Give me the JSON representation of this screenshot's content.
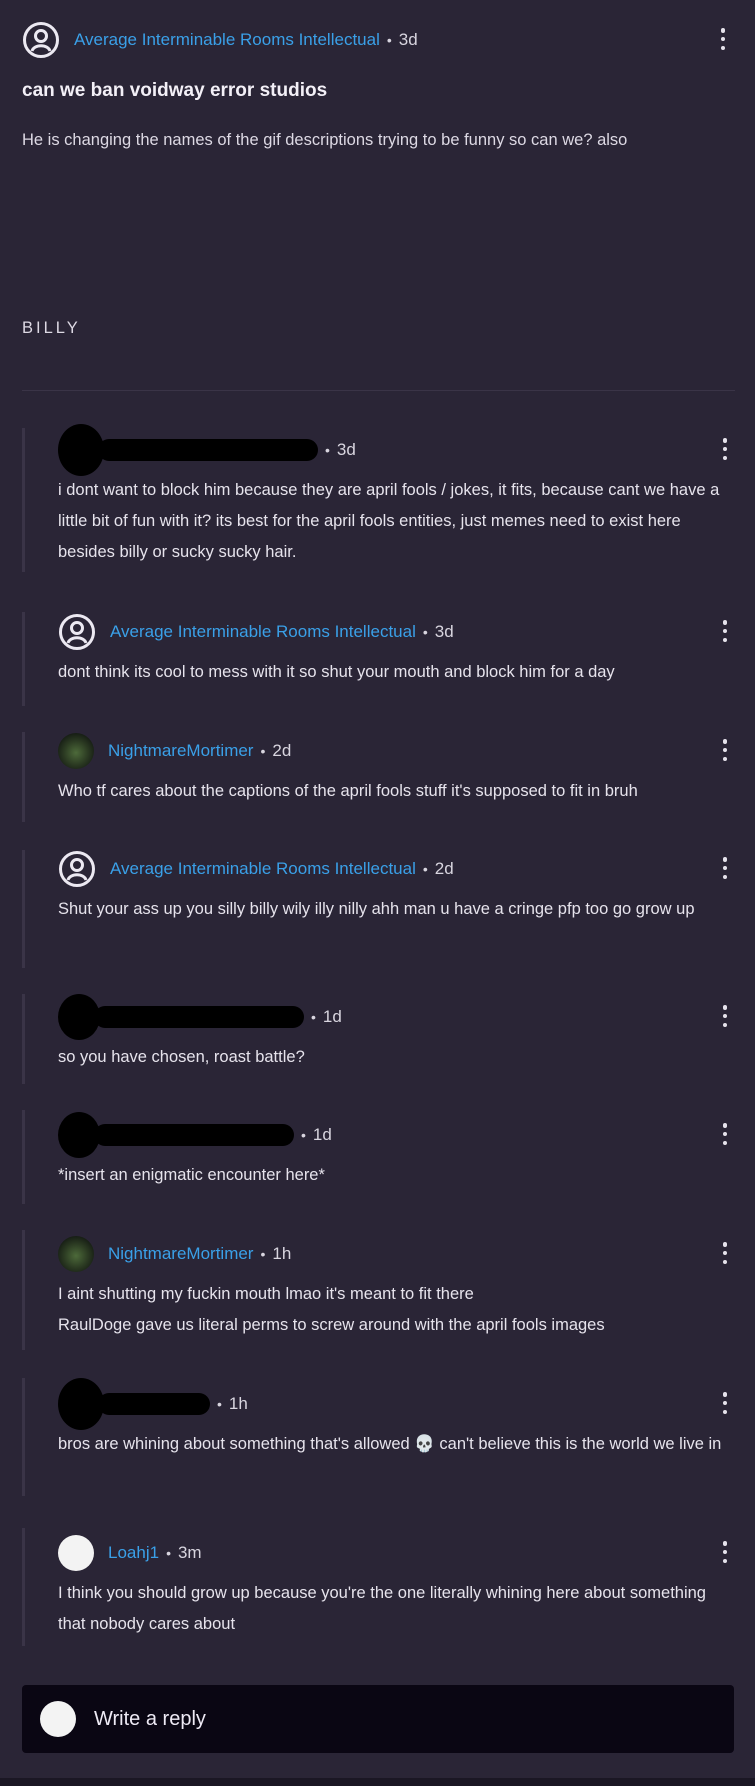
{
  "post": {
    "author": "Average Interminable Rooms Intellectual",
    "time": "3d",
    "title": "can we ban voidway error studios",
    "body": "He is changing the names of the gif descriptions trying to be funny so can we? also",
    "body2": "BILLY"
  },
  "comments": [
    {
      "author": "",
      "time": "3d",
      "text": "i dont want to block him because they are april fools / jokes, it fits, because cant we have a little bit of fun with it? its best for the april fools entities, just memes need to exist here besides billy or sucky sucky hair."
    },
    {
      "author": "Average Interminable Rooms Intellectual",
      "time": "3d",
      "text": " dont think its cool to mess with it so shut your mouth and block him for a day"
    },
    {
      "author": "NightmareMortimer",
      "time": "2d",
      "text": "Who tf cares about the captions of the april fools stuff it's supposed to fit in bruh"
    },
    {
      "author": "Average Interminable Rooms Intellectual",
      "time": "2d",
      "text": "Shut your ass up you silly billy wily illy nilly ahh man u have a cringe pfp too go grow up"
    },
    {
      "author": "",
      "time": "1d",
      "text": " so you have chosen, roast battle?"
    },
    {
      "author": "",
      "time": "1d",
      "text": "*insert an enigmatic encounter here*"
    },
    {
      "author": "NightmareMortimer",
      "time": "1h",
      "text_line1": "I aint shutting my fuckin mouth lmao it's meant to fit there",
      "text_line2": "RaulDoge gave us literal perms to screw around with the april fools images"
    },
    {
      "author": "",
      "time": "1h",
      "text": "bros are whining about something that's allowed 💀 can't believe this is the world we live in"
    },
    {
      "author": "Loahj1",
      "time": "3m",
      "text": "I think you should grow up because you're the one literally whining here about something that nobody cares about"
    }
  ],
  "reply": {
    "placeholder": "Write a reply"
  },
  "colors": {
    "background": "#2a2536",
    "username": "#3aa0e8",
    "reply_bar": "#0a0613"
  },
  "icons": {
    "default_avatar": "user-circle-icon",
    "menu": "more-vertical-icon"
  }
}
